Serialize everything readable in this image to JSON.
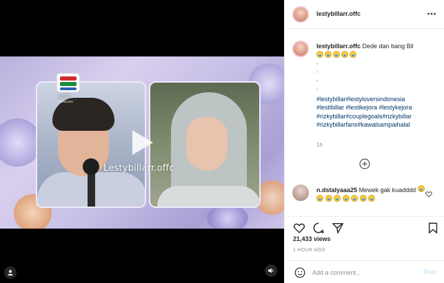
{
  "video": {
    "watermark": "Lestybillarr.offc",
    "channel_logo": "INDOSIAR",
    "live_label": "LIVE",
    "live_location": "BANDUNG"
  },
  "header": {
    "username": "lestybillarr.offc",
    "more_icon": "more-horizontal-icon"
  },
  "caption": {
    "username": "lestybillarr.offc",
    "text": "Dede dan bang Bil",
    "emoji_count": 5,
    "dots": [
      ".",
      ".",
      ".",
      "."
    ],
    "hashtags": [
      "#lestybillar#lestyloversindonesia",
      "#lestibillar #lestikejora #lestykejora",
      "#rizkybillar#couplegoals#rizkybillar",
      "#rizkybillarfans#kawalsampaihalal"
    ],
    "time": "1h"
  },
  "comment": {
    "username": "n.dstalyaaa25",
    "text": "Mewek gak kuadddd"
  },
  "actions": {
    "like_icon": "heart-icon",
    "comment_icon": "comment-icon",
    "share_icon": "paper-plane-icon",
    "save_icon": "bookmark-icon"
  },
  "stats": {
    "views": "21,433 views",
    "posted": "1 HOUR AGO"
  },
  "add_comment": {
    "placeholder": "Add a comment...",
    "post_label": "Post"
  },
  "colors": {
    "link_hashtag": "#00376b",
    "post_disabled": "#b2dffc",
    "muted": "#8e8e8e"
  }
}
